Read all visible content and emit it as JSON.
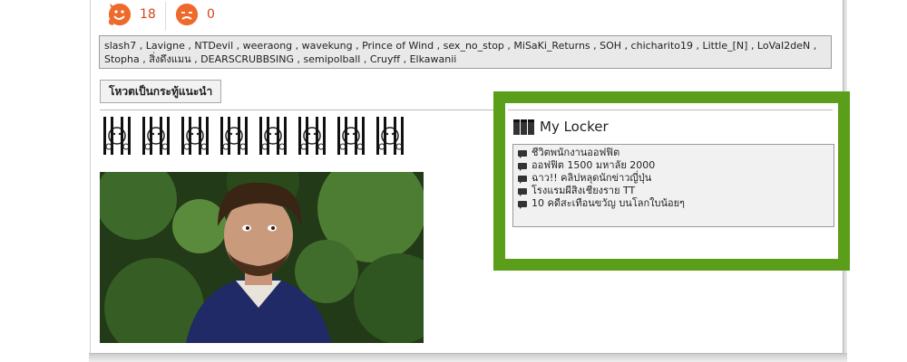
{
  "votes": {
    "up_count": "18",
    "down_count": "0"
  },
  "voters_text": "slash7 , Lavigne , NTDevil , weeraong , wavekung , Prince of Wind , sex_no_stop , MiSaKi_Returns , SOH , chicharito19 , Little_[N] , LoVaI2deN , Stopha , สิ่งดึงแมน , DEARSCRUBBSING , semipolball , Cruyff , Elkawanii",
  "recommend_button_label": "โหวตเป็นกระทู้แนะนำ",
  "stickers": [
    {
      "icon": "jail-bars-sticker-icon"
    },
    {
      "icon": "jail-bars-sticker-icon"
    },
    {
      "icon": "jail-bars-sticker-icon"
    },
    {
      "icon": "jail-bars-sticker-icon"
    },
    {
      "icon": "jail-bars-sticker-icon"
    },
    {
      "icon": "jail-bars-sticker-icon"
    },
    {
      "icon": "jail-bars-sticker-icon"
    },
    {
      "icon": "jail-bars-sticker-icon"
    }
  ],
  "locker": {
    "title": "My Locker",
    "items": [
      "ชีวิตพนักงานออฟฟิต",
      "ออฟฟิต 1500 มหาลัย 2000",
      "ฉาว!! คลิปหลุดนักข่าวญี่ปุ่น",
      "โรงแรมผีสิงเชียงราย TT",
      "10 คดีสะเทือนขวัญ บนโลกใบน้อยๆ"
    ]
  },
  "colors": {
    "highlight_border": "#5a9e19",
    "vote_count": "#d4441a",
    "face": "#ee6a2c"
  }
}
